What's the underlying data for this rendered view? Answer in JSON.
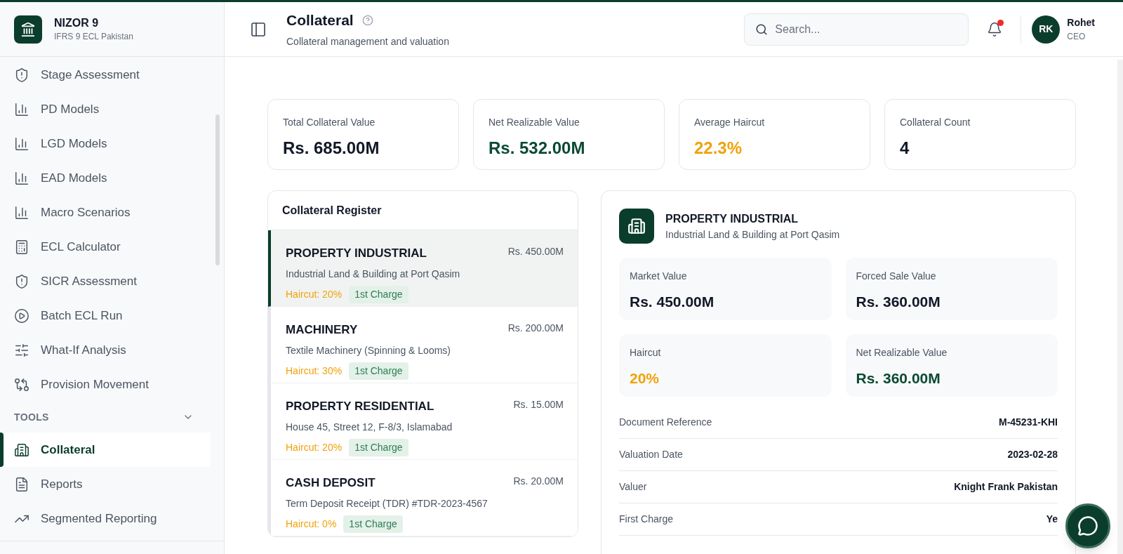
{
  "brand": {
    "name": "NIZOR 9",
    "subtitle": "IFRS 9 ECL Pakistan"
  },
  "sidebar": {
    "items": [
      {
        "label": "Stage Assessment",
        "selected": false
      },
      {
        "label": "PD Models",
        "selected": false
      },
      {
        "label": "LGD Models",
        "selected": false
      },
      {
        "label": "EAD Models",
        "selected": false
      },
      {
        "label": "Macro Scenarios",
        "selected": false
      },
      {
        "label": "ECL Calculator",
        "selected": false
      },
      {
        "label": "SICR Assessment",
        "selected": false
      },
      {
        "label": "Batch ECL Run",
        "selected": false
      },
      {
        "label": "What-If Analysis",
        "selected": false
      },
      {
        "label": "Provision Movement",
        "selected": false
      }
    ],
    "section": {
      "title": "TOOLS",
      "expanded": true,
      "items": [
        {
          "label": "Collateral",
          "selected": true
        },
        {
          "label": "Reports",
          "selected": false
        },
        {
          "label": "Segmented Reporting",
          "selected": false
        }
      ]
    }
  },
  "header": {
    "title": "Collateral",
    "subtitle": "Collateral management and valuation",
    "search": {
      "placeholder": "Search..."
    },
    "notifications": {
      "unread": true
    },
    "user": {
      "initials": "RK",
      "name": "Rohet",
      "role": "CEO"
    }
  },
  "stats": [
    {
      "label": "Total Collateral Value",
      "value": "Rs. 685.00M",
      "kind": "neutral"
    },
    {
      "label": "Net Realizable Value",
      "value": "Rs. 532.00M",
      "kind": "positive"
    },
    {
      "label": "Average Haircut",
      "value": "22.3%",
      "kind": "warning"
    },
    {
      "label": "Collateral Count",
      "value": "4",
      "kind": "neutral"
    }
  ],
  "register": {
    "title": "Collateral Register",
    "items": [
      {
        "type": "PROPERTY INDUSTRIAL",
        "description": "Industrial Land & Building at Port Qasim",
        "amount": "Rs. 450.00M",
        "haircut": "Haircut: 20%",
        "charge": "1st Charge",
        "selected": true
      },
      {
        "type": "MACHINERY",
        "description": "Textile Machinery (Spinning & Looms)",
        "amount": "Rs. 200.00M",
        "haircut": "Haircut: 30%",
        "charge": "1st Charge",
        "selected": false
      },
      {
        "type": "PROPERTY RESIDENTIAL",
        "description": "House 45, Street 12, F-8/3, Islamabad",
        "amount": "Rs. 15.00M",
        "haircut": "Haircut: 20%",
        "charge": "1st Charge",
        "selected": false
      },
      {
        "type": "CASH DEPOSIT",
        "description": "Term Deposit Receipt (TDR) #TDR-2023-4567",
        "amount": "Rs. 20.00M",
        "haircut": "Haircut: 0%",
        "charge": "1st Charge",
        "selected": false
      }
    ]
  },
  "detail": {
    "type": "PROPERTY INDUSTRIAL",
    "description": "Industrial Land & Building at Port Qasim",
    "metrics": [
      {
        "label": "Market Value",
        "value": "Rs. 450.00M",
        "kind": "neutral"
      },
      {
        "label": "Forced Sale Value",
        "value": "Rs. 360.00M",
        "kind": "neutral"
      },
      {
        "label": "Haircut",
        "value": "20%",
        "kind": "warning"
      },
      {
        "label": "Net Realizable Value",
        "value": "Rs. 360.00M",
        "kind": "positive"
      }
    ],
    "fields": [
      {
        "label": "Document Reference",
        "value": "M-45231-KHI"
      },
      {
        "label": "Valuation Date",
        "value": "2023-02-28"
      },
      {
        "label": "Valuer",
        "value": "Knight Frank Pakistan"
      },
      {
        "label": "First Charge",
        "value": "Ye"
      }
    ]
  }
}
